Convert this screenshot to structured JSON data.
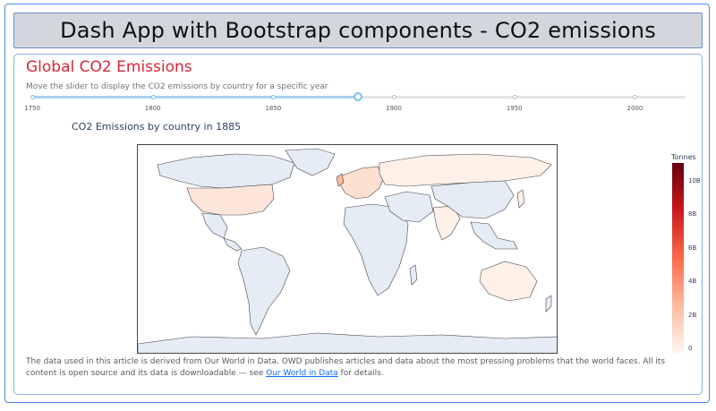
{
  "header": {
    "title": "Dash App with Bootstrap components - CO2 emissions"
  },
  "card": {
    "title": "Global CO2 Emissions",
    "subtitle": "Move the slider to display the CO2 emissions by country for a specific year"
  },
  "slider": {
    "min": 1750,
    "max": 2021,
    "value": 1885,
    "marks": [
      "1750",
      "1800",
      "1850",
      "1900",
      "1950",
      "2000"
    ]
  },
  "map": {
    "title": "CO2 Emissions by country in 1885",
    "colorbar_title": "Tonnes",
    "colorbar_ticks": [
      "10B",
      "8B",
      "6B",
      "4B",
      "2B",
      "0"
    ],
    "colorscale": [
      "#fff5f0",
      "#fcbba1",
      "#fb6a4a",
      "#cb181d",
      "#67000d"
    ],
    "no_data_color": "#e5ecf6"
  },
  "footer": {
    "text_before": "The data used in this article is derived from Our World in Data. OWD publishes articles and data about the most pressing problems that the world faces. All its content is open source and its data is downloadable — see ",
    "link_text": "Our World in Data",
    "text_after": " for details."
  }
}
